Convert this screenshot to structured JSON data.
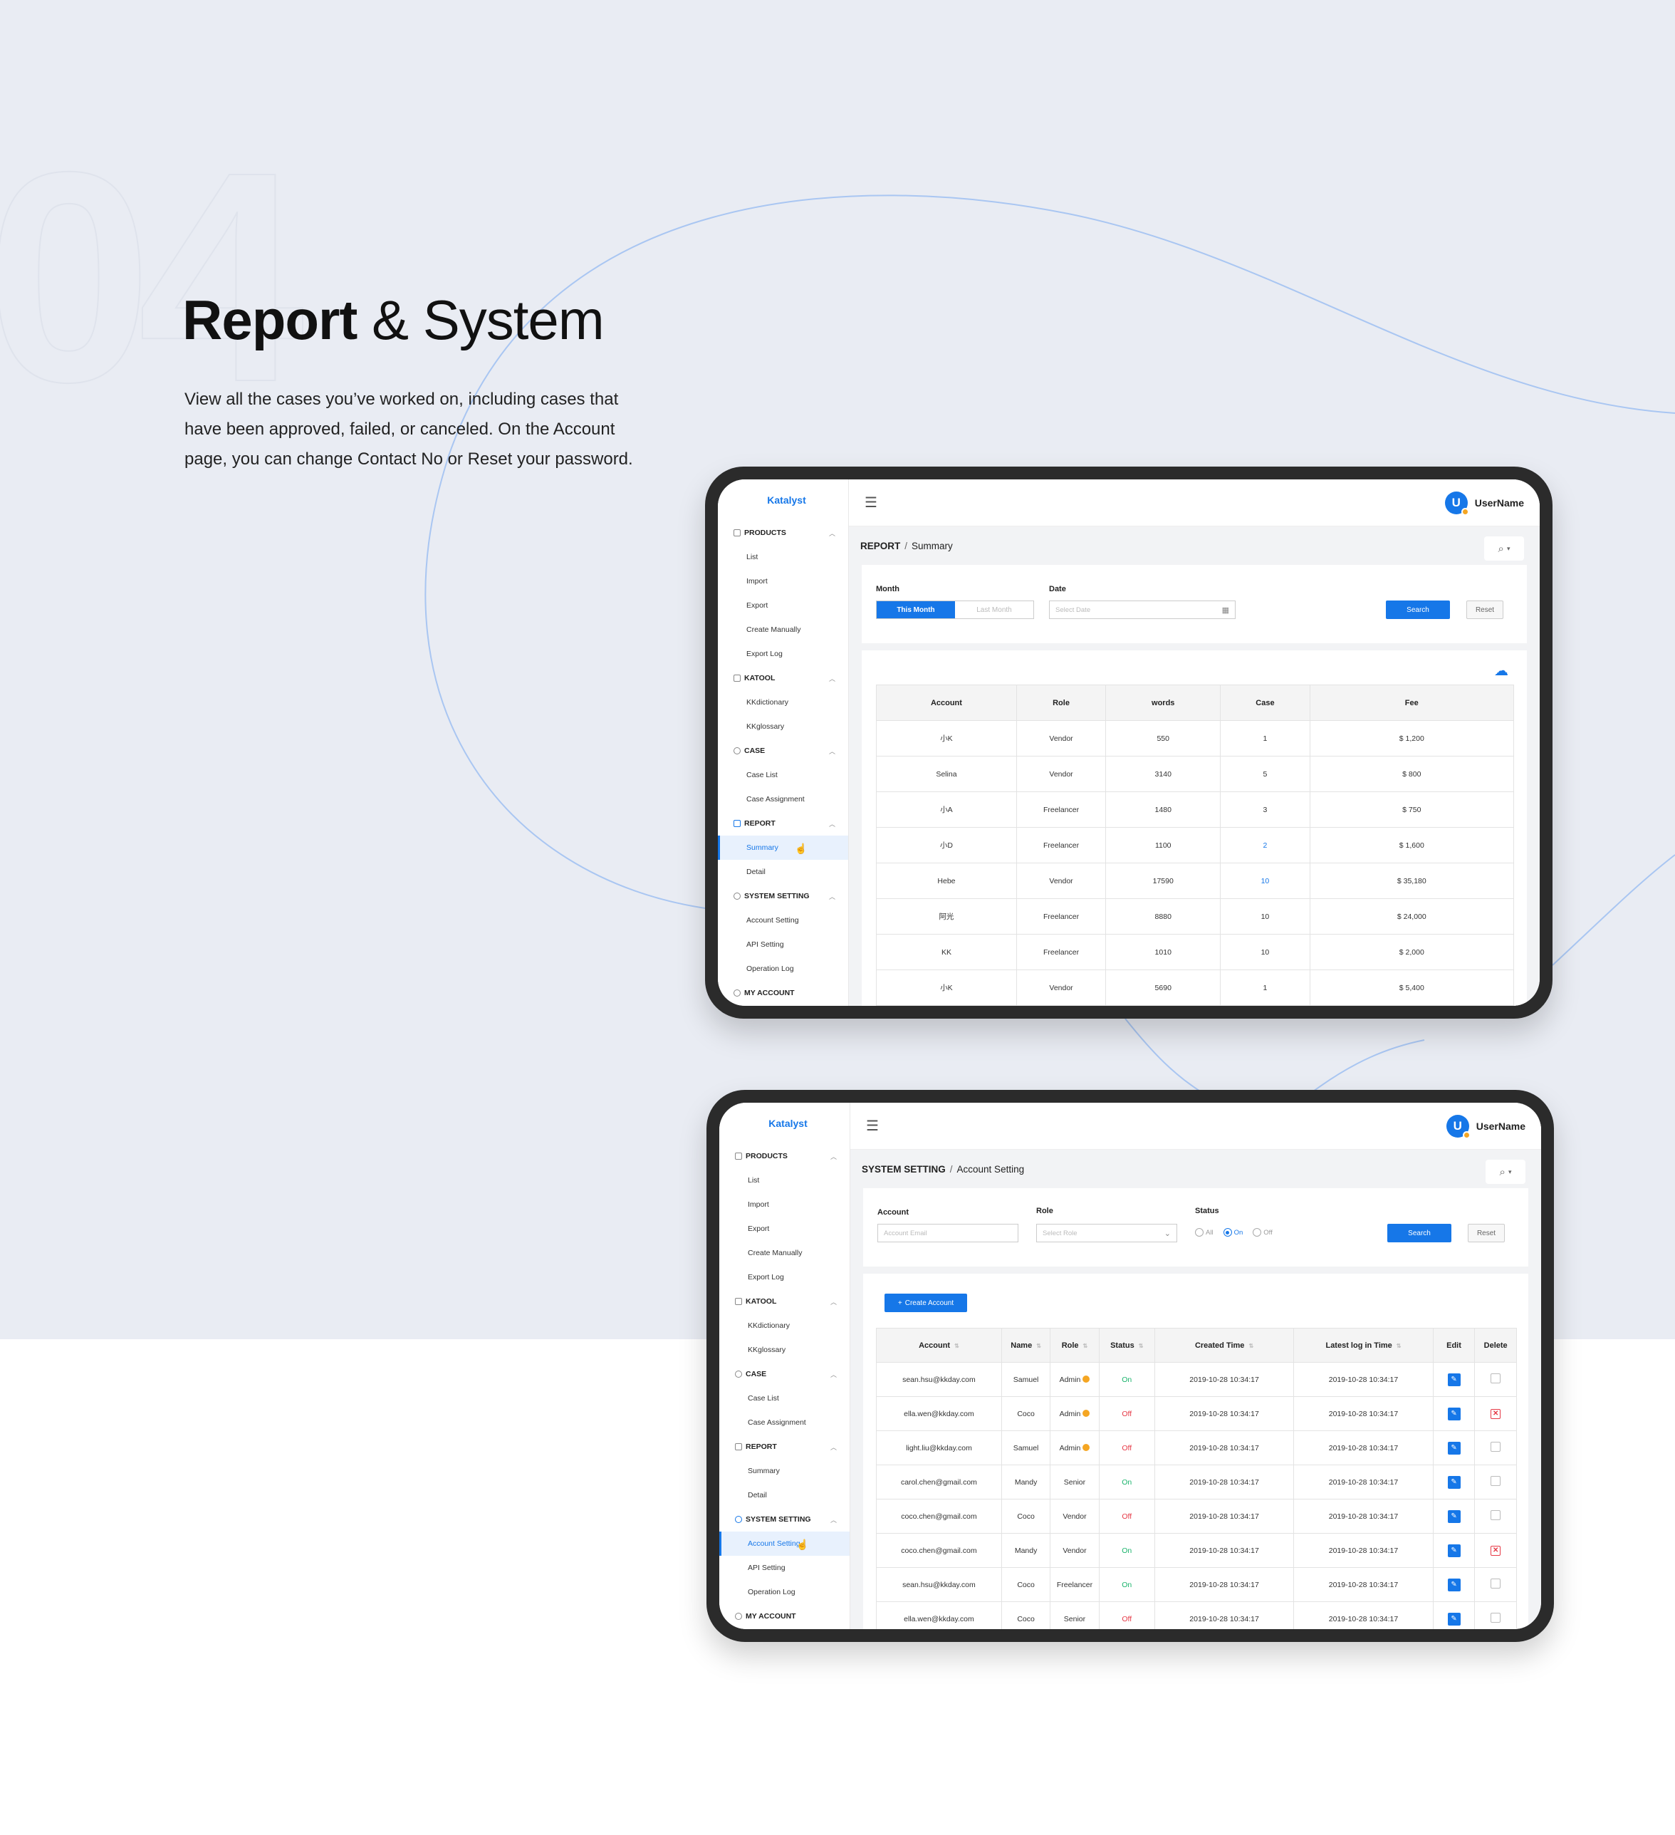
{
  "page": {
    "section_number": "04",
    "headline_bold": "Report",
    "headline_rest": "& System",
    "intro": "View all the cases you’ve worked on, including cases that have been approved, failed, or canceled. On the Account page, you can change Contact No or Reset your password."
  },
  "colors": {
    "accent": "#1677e8",
    "on": "#19b36b",
    "off": "#e63946",
    "badge": "#f5a623",
    "background": "#e9ecf3"
  },
  "app": {
    "brand": "Katalyst",
    "username": "UserName",
    "avatar_letter": "U",
    "sidebar": {
      "products": "PRODUCTS",
      "products_items": [
        "List",
        "Import",
        "Export",
        "Create Manually",
        "Export Log"
      ],
      "katool": "KATOOL",
      "katool_items": [
        "KKdictionary",
        "KKglossary"
      ],
      "case": "CASE",
      "case_items": [
        "Case List",
        "Case Assignment"
      ],
      "report": "REPORT",
      "report_items": [
        "Summary",
        "Detail"
      ],
      "system": "SYSTEM SETTING",
      "system_items": [
        "Account Setting",
        "API Setting",
        "Operation Log"
      ],
      "my_account": "MY ACCOUNT"
    }
  },
  "report_screen": {
    "breadcrumb_parent": "REPORT",
    "breadcrumb_current": "Summary",
    "filters": {
      "month_label": "Month",
      "month_options": [
        "This Month",
        "Last Month"
      ],
      "month_selected": "This Month",
      "date_label": "Date",
      "date_placeholder": "Select Date",
      "search": "Search",
      "reset": "Reset"
    },
    "table": {
      "columns": [
        "Account",
        "Role",
        "words",
        "Case",
        "Fee"
      ],
      "rows": [
        [
          "小K",
          "Vendor",
          "550",
          "1",
          "$ 1,200"
        ],
        [
          "Selina",
          "Vendor",
          "3140",
          "5",
          "$ 800"
        ],
        [
          "小A",
          "Freelancer",
          "1480",
          "3",
          "$ 750"
        ],
        [
          "小D",
          "Freelancer",
          "1100",
          "2",
          "$ 1,600"
        ],
        [
          "Hebe",
          "Vendor",
          "17590",
          "10",
          "$ 35,180"
        ],
        [
          "阿光",
          "Freelancer",
          "8880",
          "10",
          "$ 24,000"
        ],
        [
          "KK",
          "Freelancer",
          "1010",
          "10",
          "$ 2,000"
        ],
        [
          "小K",
          "Vendor",
          "5690",
          "1",
          "$ 5,400"
        ]
      ]
    }
  },
  "account_screen": {
    "breadcrumb_parent": "SYSTEM SETTING",
    "breadcrumb_current": "Account Setting",
    "filters": {
      "account_label": "Account",
      "account_placeholder": "Account Email",
      "role_label": "Role",
      "role_placeholder": "Select Role",
      "status_label": "Status",
      "status_options": [
        "All",
        "On",
        "Off"
      ],
      "status_selected": "On",
      "search": "Search",
      "reset": "Reset"
    },
    "create_button": "Create Account",
    "table": {
      "columns": [
        "Account",
        "Name",
        "Role",
        "Status",
        "Created Time",
        "Latest log in Time",
        "Edit",
        "Delete"
      ],
      "rows": [
        {
          "account": "sean.hsu@kkday.com",
          "name": "Samuel",
          "role": "Admin",
          "admin_badge": true,
          "status": "On",
          "created": "2019-10-28 10:34:17",
          "latest": "2019-10-28 10:34:17",
          "delete_marked": false
        },
        {
          "account": "ella.wen@kkday.com",
          "name": "Coco",
          "role": "Admin",
          "admin_badge": true,
          "status": "Off",
          "created": "2019-10-28 10:34:17",
          "latest": "2019-10-28 10:34:17",
          "delete_marked": true
        },
        {
          "account": "light.liu@kkday.com",
          "name": "Samuel",
          "role": "Admin",
          "admin_badge": true,
          "status": "Off",
          "created": "2019-10-28 10:34:17",
          "latest": "2019-10-28 10:34:17",
          "delete_marked": false
        },
        {
          "account": "carol.chen@gmail.com",
          "name": "Mandy",
          "role": "Senior",
          "admin_badge": false,
          "status": "On",
          "created": "2019-10-28 10:34:17",
          "latest": "2019-10-28 10:34:17",
          "delete_marked": false
        },
        {
          "account": "coco.chen@gmail.com",
          "name": "Coco",
          "role": "Vendor",
          "admin_badge": false,
          "status": "Off",
          "created": "2019-10-28 10:34:17",
          "latest": "2019-10-28 10:34:17",
          "delete_marked": false
        },
        {
          "account": "coco.chen@gmail.com",
          "name": "Mandy",
          "role": "Vendor",
          "admin_badge": false,
          "status": "On",
          "created": "2019-10-28 10:34:17",
          "latest": "2019-10-28 10:34:17",
          "delete_marked": true
        },
        {
          "account": "sean.hsu@kkday.com",
          "name": "Coco",
          "role": "Freelancer",
          "admin_badge": false,
          "status": "On",
          "created": "2019-10-28 10:34:17",
          "latest": "2019-10-28 10:34:17",
          "delete_marked": false
        },
        {
          "account": "ella.wen@kkday.com",
          "name": "Coco",
          "role": "Senior",
          "admin_badge": false,
          "status": "Off",
          "created": "2019-10-28 10:34:17",
          "latest": "2019-10-28 10:34:17",
          "delete_marked": false
        }
      ]
    }
  }
}
